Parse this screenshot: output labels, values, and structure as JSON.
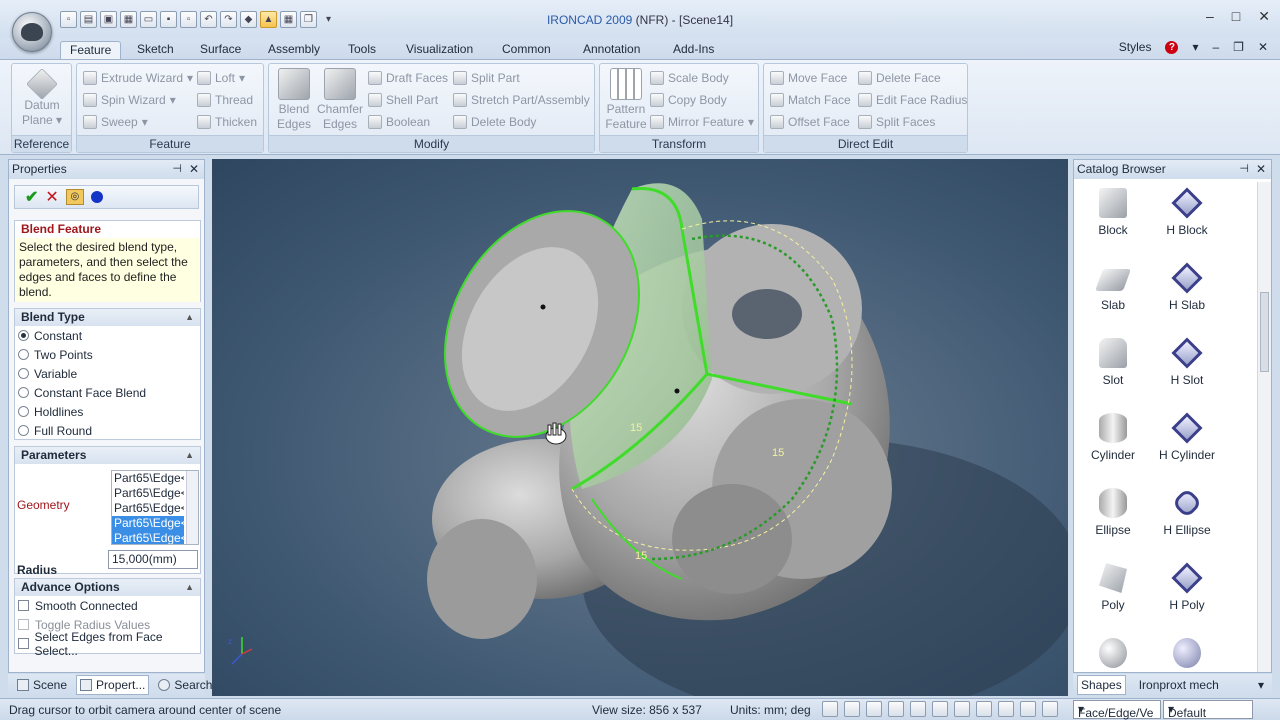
{
  "titlebar": {
    "app_name": "IRONCAD 2009",
    "title_rest": " (NFR) - [Scene14]",
    "minimize": "–",
    "maximize": "□",
    "close": "✕"
  },
  "qat_icons": [
    "new-icon",
    "open-icon",
    "close-doc-icon",
    "print-icon",
    "folder-icon",
    "save-icon",
    "save-as-icon",
    "undo-icon",
    "redo-icon",
    "render-icon",
    "select-icon",
    "tools-icon",
    "copy-icon",
    "dropdown-icon"
  ],
  "tabs": [
    "Feature",
    "Sketch",
    "Surface",
    "Assembly",
    "Tools",
    "Visualization",
    "Common",
    "Annotation",
    "Add-Ins"
  ],
  "top_right": {
    "styles": "Styles",
    "help": "?"
  },
  "ribbon": {
    "reference": {
      "label": "Reference",
      "datum": "Datum",
      "plane": "Plane"
    },
    "feature": {
      "label": "Feature",
      "extrude": "Extrude Wizard",
      "loft": "Loft",
      "spin": "Spin Wizard",
      "thread": "Thread",
      "sweep": "Sweep",
      "thicken": "Thicken"
    },
    "modify": {
      "label": "Modify",
      "blend1": "Blend",
      "blend2": "Edges",
      "chamfer1": "Chamfer",
      "chamfer2": "Edges",
      "draft": "Draft Faces",
      "split_part": "Split Part",
      "shell": "Shell Part",
      "stretch": "Stretch Part/Assembly",
      "boolean": "Boolean",
      "delete_body": "Delete Body"
    },
    "transform": {
      "label": "Transform",
      "pattern1": "Pattern",
      "pattern2": "Feature",
      "scale": "Scale Body",
      "copy": "Copy Body",
      "mirror": "Mirror Feature"
    },
    "direct": {
      "label": "Direct Edit",
      "move": "Move Face",
      "delete_face": "Delete Face",
      "match": "Match Face",
      "edit_radius": "Edit Face Radius",
      "offset": "Offset Face",
      "split_faces": "Split Faces"
    }
  },
  "properties": {
    "title": "Properties",
    "blend_feature": {
      "heading": "Blend Feature",
      "desc": "Select the desired blend type, parameters, and then select the edges and faces to define the blend."
    },
    "blend_type": {
      "heading": "Blend Type",
      "options": [
        "Constant",
        "Two Points",
        "Variable",
        "Constant Face Blend",
        "Holdlines",
        "Full Round"
      ],
      "selected": 0
    },
    "parameters": {
      "heading": "Parameters",
      "geometry_label": "Geometry",
      "geometry": [
        "Part65\\Edge<",
        "Part65\\Edge<",
        "Part65\\Edge<",
        "Part65\\Edge<",
        "Part65\\Edge<"
      ],
      "radius_label": "Radius",
      "radius_value": "15,000(mm)"
    },
    "advance": {
      "heading": "Advance Options",
      "smooth": "Smooth Connected",
      "toggle": "Toggle Radius Values",
      "select_edges": "Select Edges from Face Select..."
    }
  },
  "left_tabs": {
    "scene": "Scene",
    "properties": "Propert...",
    "search": "Search"
  },
  "viewport": {
    "label1": "15",
    "label2": "15",
    "label3": "15"
  },
  "catalog": {
    "title": "Catalog Browser",
    "items": [
      "Block",
      "H Block",
      "Slab",
      "H Slab",
      "Slot",
      "H Slot",
      "Cylinder",
      "H Cylinder",
      "Ellipse",
      "H Ellipse",
      "Poly",
      "H Poly"
    ],
    "tabs": {
      "shapes": "Shapes",
      "mech": "Ironproxt mech"
    }
  },
  "status": {
    "hint": "Drag cursor to orbit camera around center of scene",
    "view_size": "View size:  856 x 537",
    "units": "Units: mm; deg",
    "filter": "Face/Edge/Ve",
    "default": "Default"
  },
  "colors": {
    "accent": "#2b5aa8",
    "selection_green": "#3fdc2a",
    "heading_red": "#a0171c"
  }
}
